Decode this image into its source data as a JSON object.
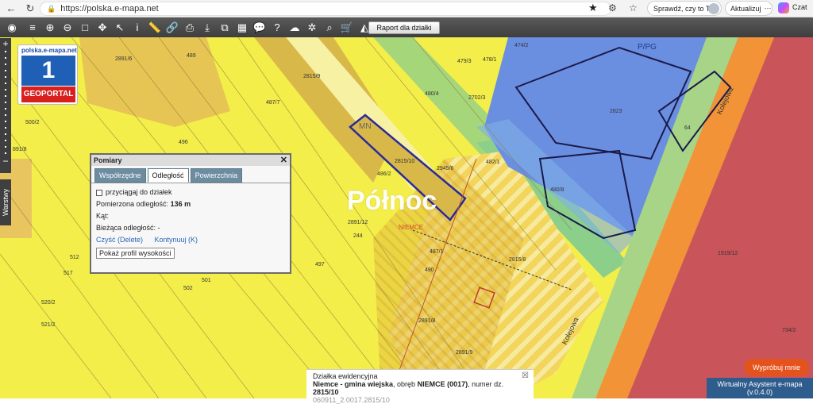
{
  "browser": {
    "url": "https://polska.e-mapa.net",
    "profile_label": "Sprawdź, czy to Ty",
    "update_label": "Aktualizuj",
    "copilot_label": "Czat",
    "icons": [
      "back-icon",
      "refresh-icon",
      "lock-icon",
      "star-icon",
      "extensions-icon",
      "favorites-icon"
    ]
  },
  "toolbar": {
    "raport_label": "Raport dla działki"
  },
  "logo": {
    "site": "polska.e-mapa.net",
    "number": "1",
    "name": "GEOPORTAL"
  },
  "sidebar": {
    "warstwy_label": "Warstwy",
    "zoom_in": "+",
    "zoom_out": "−"
  },
  "pomiary": {
    "title": "Pomiary",
    "tabs": [
      "Współrzędne",
      "Odległość",
      "Powierzchnia"
    ],
    "active_tab": "Odległość",
    "snap_label": "przyciągaj do działek",
    "measured_label": "Pomierzona odległość:",
    "measured_value": "136 m",
    "angle_label": "Kąt:",
    "current_label": "Bieżąca odległość: -",
    "clear_link": "Czyść (Delete)",
    "continue_link": "Kontynuuj (K)",
    "profile_button": "Pokaż profil wysokości"
  },
  "watermark": "Północ",
  "map_labels": {
    "parcels": [
      "2891/6",
      "489",
      "2815/9",
      "487/7",
      "496",
      "500/2",
      "2815/10",
      "486/2",
      "2945/6",
      "482/1",
      "480/8",
      "480/4",
      "2702/3",
      "479/3",
      "478/1",
      "474/2",
      "2891/12",
      "244",
      "487/1",
      "490",
      "2815/8",
      "497",
      "501",
      "502",
      "512",
      "517",
      "520/2",
      "521/2",
      "2891/8",
      "2891/9",
      "1919/12",
      "734/2",
      "2823",
      "64",
      "891/8"
    ],
    "zone_mn": "MN",
    "zone_pg": "P/PG",
    "place_niemce": "NIEMCE",
    "street": "Kolejowa"
  },
  "infobox": {
    "title": "Działka ewidencyjna",
    "description_prefix": "Niemce - gmina wiejska",
    "description_mid": ", obręb ",
    "obreb": "NIEMCE (0017)",
    "description_suffix": ", numer dz.",
    "parcel_number": "2815/10",
    "identifier": "060911_2.0017.2815/10"
  },
  "assistant": {
    "label": "Wirtualny Asystent e-mapa",
    "version": "(v.0.4.0)",
    "try_label": "Wypróbuj mnie"
  }
}
